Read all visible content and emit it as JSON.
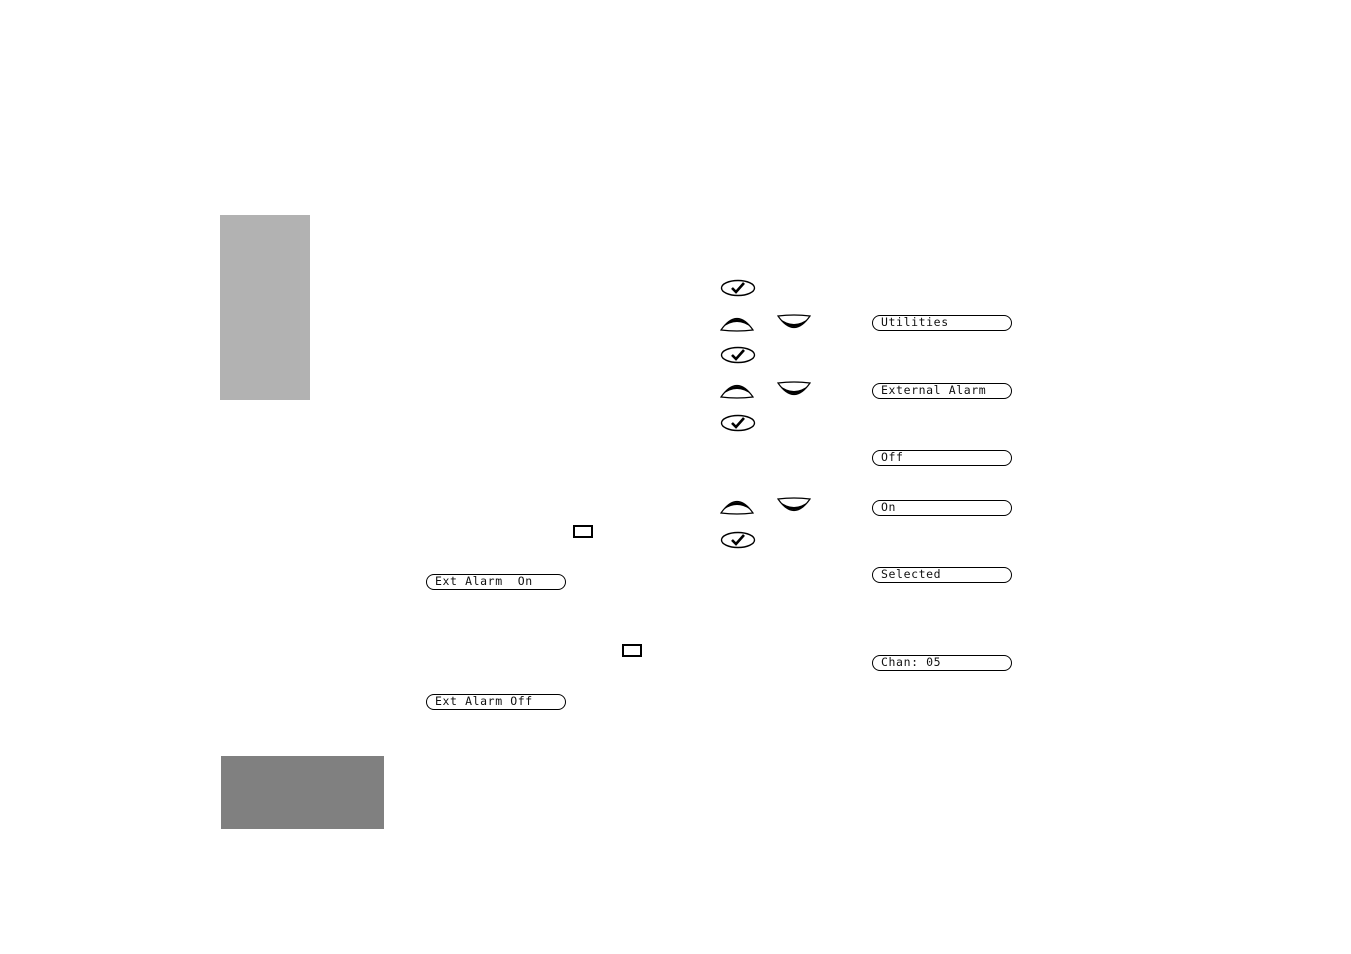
{
  "colors": {
    "tab_top": "#b2b2b2",
    "tab_bottom": "#808080",
    "ink": "#000000"
  },
  "procedure": {
    "steps": [
      {
        "keys": [
          "menu-select-icon"
        ],
        "display": ""
      },
      {
        "keys": [
          "scroll-up-icon",
          "scroll-down-icon"
        ],
        "display": "Utilities"
      },
      {
        "keys": [
          "menu-select-icon"
        ],
        "display": ""
      },
      {
        "keys": [
          "scroll-up-icon",
          "scroll-down-icon"
        ],
        "display": "External Alarm"
      },
      {
        "keys": [
          "menu-select-icon"
        ],
        "display": ""
      },
      {
        "keys": [],
        "display": "Off"
      },
      {
        "keys": [
          "scroll-up-icon",
          "scroll-down-icon"
        ],
        "display": "On"
      },
      {
        "keys": [
          "menu-select-icon"
        ],
        "display": ""
      },
      {
        "keys": [],
        "display": "Selected"
      },
      {
        "keys": [],
        "display": "Chan: 05"
      }
    ],
    "displays": {
      "utilities": "Utilities",
      "external_alarm": "External Alarm",
      "off": "Off",
      "on": "On",
      "selected": "Selected",
      "chan": "Chan: 05"
    }
  },
  "shortcut": {
    "on_display": "Ext Alarm  On",
    "off_display": "Ext Alarm Off",
    "button_icon": "programmable-button-icon"
  }
}
